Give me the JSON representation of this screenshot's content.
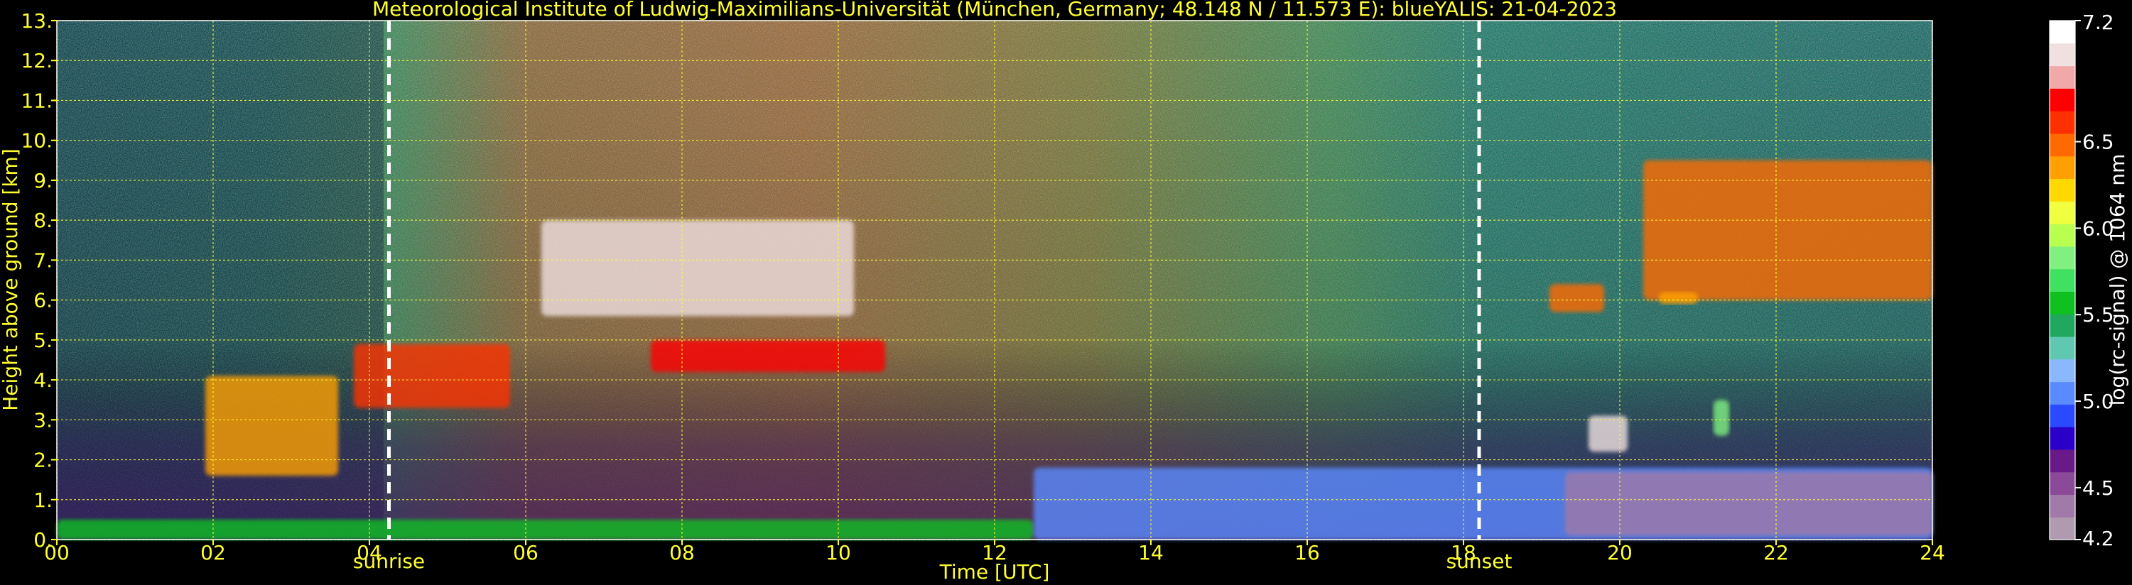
{
  "chart_data": {
    "type": "heatmap",
    "title": "Meteorological Institute of Ludwig-Maximilians-Universität (München, Germany; 48.148 N / 11.573 E):    blueYALIS: 21-04-2023",
    "xlabel": "Time [UTC]",
    "ylabel": "Height above ground [km]",
    "xlim": [
      0,
      24
    ],
    "ylim": [
      0,
      13
    ],
    "xticks": [
      "00",
      "02",
      "04",
      "06",
      "08",
      "10",
      "12",
      "14",
      "16",
      "18",
      "20",
      "22",
      "24"
    ],
    "yticks": [
      "0.",
      "1.",
      "2.",
      "3.",
      "4.",
      "5.",
      "6.",
      "7.",
      "8.",
      "9.",
      "10.",
      "11.",
      "12.",
      "13."
    ],
    "grid": true,
    "annotations": [
      {
        "label": "sunrise",
        "x": 4.25
      },
      {
        "label": "sunset",
        "x": 18.2
      }
    ],
    "colorbar": {
      "label": "log(rc-signal) @ 1064 nm",
      "range": [
        4.2,
        7.2
      ],
      "tick_values": [
        4.2,
        4.5,
        5.0,
        5.5,
        6.0,
        6.5,
        7.2
      ],
      "tick_labels": [
        "4.2",
        "4.5",
        "5.0",
        "5.5",
        "6.0",
        "6.5",
        "7.2"
      ],
      "colors": [
        "#b09ab0",
        "#a07aa8",
        "#8a4a98",
        "#6a1a88",
        "#2a00c8",
        "#2a4aff",
        "#5a8aff",
        "#8ab8ff",
        "#60c8b0",
        "#20a860",
        "#10c020",
        "#40e060",
        "#80f080",
        "#b8ff50",
        "#f0ff40",
        "#ffd800",
        "#ffa000",
        "#ff6a00",
        "#ff3000",
        "#ff0000",
        "#f0a8a8",
        "#f0e0e0",
        "#ffffff"
      ]
    },
    "features": [
      {
        "x": [
          3.8,
          5.8
        ],
        "y": [
          3.3,
          4.9
        ],
        "level": 6.6
      },
      {
        "x": [
          1.9,
          3.6
        ],
        "y": [
          1.6,
          4.1
        ],
        "level": 6.4
      },
      {
        "x": [
          20.3,
          24.0
        ],
        "y": [
          6.0,
          9.5
        ],
        "level": 6.5
      },
      {
        "x": [
          19.1,
          19.8
        ],
        "y": [
          5.7,
          6.4
        ],
        "level": 6.5
      },
      {
        "x": [
          20.5,
          21.0
        ],
        "y": [
          5.9,
          6.2
        ],
        "level": 6.4
      },
      {
        "x": [
          6.2,
          10.2
        ],
        "y": [
          5.6,
          8.0
        ],
        "level": 7.0
      },
      {
        "x": [
          7.6,
          10.6
        ],
        "y": [
          4.2,
          5.0
        ],
        "level": 6.8
      },
      {
        "x": [
          0.0,
          12.5
        ],
        "y": [
          0.0,
          0.5
        ],
        "level": 5.6
      },
      {
        "x": [
          12.5,
          24.0
        ],
        "y": [
          0.0,
          1.8
        ],
        "level": 5.0
      },
      {
        "x": [
          19.3,
          24.0
        ],
        "y": [
          0.1,
          1.7
        ],
        "level": 4.4
      },
      {
        "x": [
          19.6,
          20.1
        ],
        "y": [
          2.2,
          3.1
        ],
        "level": 7.0
      },
      {
        "x": [
          21.2,
          21.4
        ],
        "y": [
          2.6,
          3.5
        ],
        "level": 5.8
      }
    ]
  }
}
